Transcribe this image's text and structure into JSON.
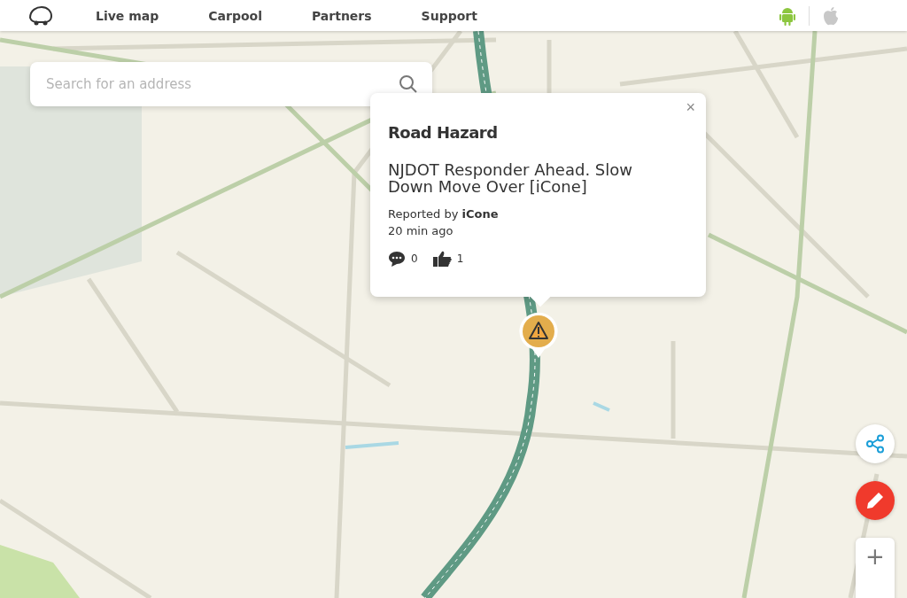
{
  "nav": {
    "links": [
      {
        "label": "Live map"
      },
      {
        "label": "Carpool"
      },
      {
        "label": "Partners"
      },
      {
        "label": "Support"
      }
    ]
  },
  "search": {
    "placeholder": "Search for an address"
  },
  "popup": {
    "title": "Road Hazard",
    "description": "NJDOT Responder Ahead. Slow Down Move Over [iCone]",
    "reported_by": "Reported by **iCone**",
    "time": "20 min ago",
    "comments": "0",
    "thumbs_up": "1",
    "close": "×"
  },
  "controls": {
    "zoom_in": "+"
  }
}
